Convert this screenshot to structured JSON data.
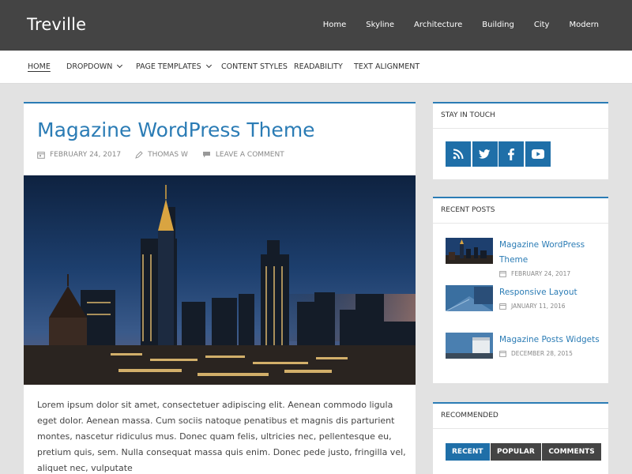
{
  "header": {
    "site_title": "Treville",
    "top_nav": [
      "Home",
      "Skyline",
      "Architecture",
      "Building",
      "City",
      "Modern"
    ]
  },
  "main_nav": {
    "items": [
      {
        "label": "HOME",
        "active": true,
        "dropdown": false
      },
      {
        "label": "DROPDOWN",
        "active": false,
        "dropdown": true
      },
      {
        "label": "PAGE TEMPLATES",
        "active": false,
        "dropdown": true
      },
      {
        "label": "CONTENT STYLES",
        "active": false,
        "dropdown": false
      },
      {
        "label": "READABILITY",
        "active": false,
        "dropdown": false
      },
      {
        "label": "TEXT ALIGNMENT",
        "active": false,
        "dropdown": false
      }
    ]
  },
  "post": {
    "title": "Magazine WordPress Theme",
    "date": "FEBRUARY 24, 2017",
    "author": "THOMAS W",
    "comments": "LEAVE A COMMENT",
    "excerpt": "Lorem ipsum dolor sit amet, consectetuer adipiscing elit. Aenean commodo ligula eget dolor. Aenean massa. Cum sociis natoque penatibus et magnis dis parturient montes, nascetur ridiculus mus. Donec quam felis, ultricies nec, pellentesque eu, pretium quis, sem. Nulla consequat massa quis enim. Donec pede justo, fringilla vel, aliquet nec, vulputate"
  },
  "sidebar": {
    "stay_in_touch": {
      "title": "STAY IN TOUCH",
      "icons": [
        "rss-icon",
        "twitter-icon",
        "facebook-icon",
        "youtube-icon"
      ]
    },
    "recent_posts": {
      "title": "RECENT POSTS",
      "items": [
        {
          "title": "Magazine WordPress Theme",
          "date": "FEBRUARY 24, 2017"
        },
        {
          "title": "Responsive Layout",
          "date": "JANUARY 11, 2016"
        },
        {
          "title": "Magazine Posts Widgets",
          "date": "DECEMBER 28, 2015"
        }
      ]
    },
    "recommended": {
      "title": "RECOMMENDED",
      "tabs": [
        "RECENT",
        "POPULAR",
        "COMMENTS"
      ],
      "active_tab": "RECENT"
    }
  },
  "colors": {
    "accent": "#2b7cb5",
    "header_bg": "#444444",
    "page_bg": "#e2e2e2"
  }
}
